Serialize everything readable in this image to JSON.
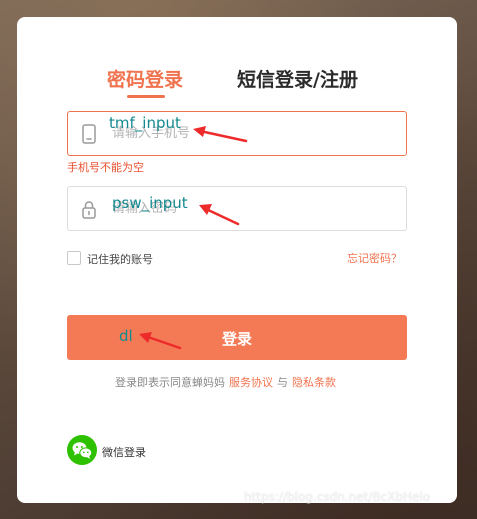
{
  "tabs": {
    "password_login": "密码登录",
    "sms_login": "短信登录/注册"
  },
  "phone_field": {
    "placeholder": "请输入手机号",
    "value": "",
    "error": "手机号不能为空",
    "icon": "phone-icon"
  },
  "password_field": {
    "placeholder": "请输入密码",
    "value": "",
    "icon": "lock-icon"
  },
  "remember": {
    "label": "记住我的账号",
    "checked": false
  },
  "forgot_password": "忘记密码？",
  "login_button": "登录",
  "agreement": {
    "prefix": "登录即表示同意蝉妈妈",
    "service": "服务协议",
    "and": "与",
    "privacy": "隐私条款"
  },
  "wechat": {
    "label": "微信登录",
    "icon": "wechat-icon"
  },
  "annotations": {
    "phone": "tmf_input",
    "password": "psw_input",
    "button": "dl"
  },
  "watermark": "https://blog.csdn.net/BcXbHelo",
  "colors": {
    "accent": "#f0734f",
    "button": "#f47a56",
    "error": "#e8502f",
    "annotation": "#13898f",
    "arrow": "#ee2b2b",
    "wechat": "#2dc100"
  }
}
